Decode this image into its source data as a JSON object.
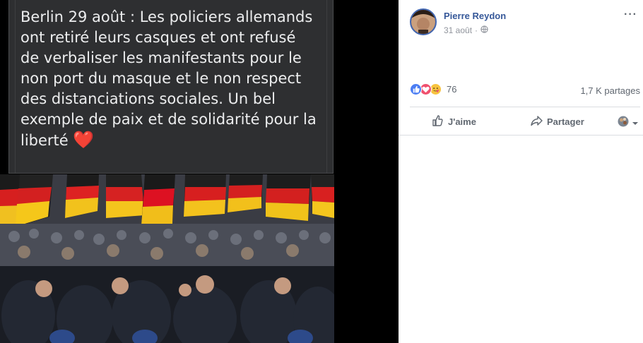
{
  "post": {
    "caption": "Berlin 29 août : Les policiers allemands ont retiré leurs casques et ont refusé de verbaliser les manifestants pour le non port du masque et le non respect des distanciations sociales. Un bel exemple de paix et de solidarité pour la liberté",
    "caption_emoji": "❤️"
  },
  "panel": {
    "author": "Pierre Reydon",
    "date": "31 août",
    "date_separator": "·",
    "more_label": "···",
    "reaction_count": "76",
    "shares": "1,7 K partages",
    "like_label": "J'aime",
    "share_label": "Partager"
  },
  "colors": {
    "author_link": "#365899",
    "like_blue": "#4c7ef3",
    "love_red": "#f0506e",
    "care_yellow": "#f7c33f"
  },
  "icons": [
    "globe-icon",
    "more-icon",
    "like-reaction-icon",
    "love-reaction-icon",
    "care-reaction-icon",
    "thumbs-up-icon",
    "share-arrow-icon",
    "audience-selector-icon",
    "chevron-down-icon"
  ]
}
